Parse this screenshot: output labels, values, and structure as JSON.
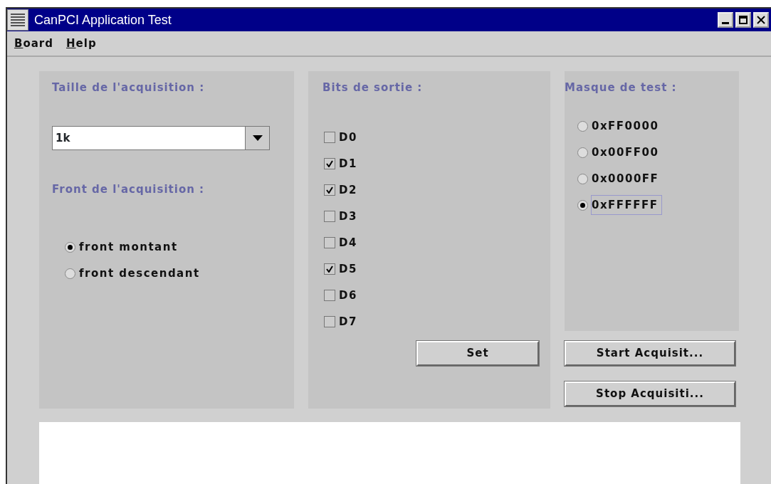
{
  "window": {
    "title": "CanPCI Application Test"
  },
  "menu": [
    "Board",
    "Help"
  ],
  "acquisition_panel": {
    "size_label": "Taille de l'acquisition :",
    "size_value": "1k",
    "edge_label": "Front de l'acquisition :",
    "edges": [
      {
        "label": "front montant",
        "selected": true
      },
      {
        "label": "front descendant",
        "selected": false
      }
    ]
  },
  "output_bits": {
    "label": "Bits de sortie :",
    "bits": [
      {
        "label": "D0",
        "checked": false
      },
      {
        "label": "D1",
        "checked": true
      },
      {
        "label": "D2",
        "checked": true
      },
      {
        "label": "D3",
        "checked": false
      },
      {
        "label": "D4",
        "checked": false
      },
      {
        "label": "D5",
        "checked": true
      },
      {
        "label": "D6",
        "checked": false
      },
      {
        "label": "D7",
        "checked": false
      }
    ],
    "button": "Set"
  },
  "test_mask": {
    "label": "Masque de test :",
    "options": [
      {
        "label": "0xFF0000",
        "selected": false
      },
      {
        "label": "0x00FF00",
        "selected": false
      },
      {
        "label": "0x0000FF",
        "selected": false
      },
      {
        "label": "0xFFFFFF",
        "selected": true
      }
    ]
  },
  "buttons": [
    "Start Acquisit...",
    "Stop Acquisiti..."
  ]
}
